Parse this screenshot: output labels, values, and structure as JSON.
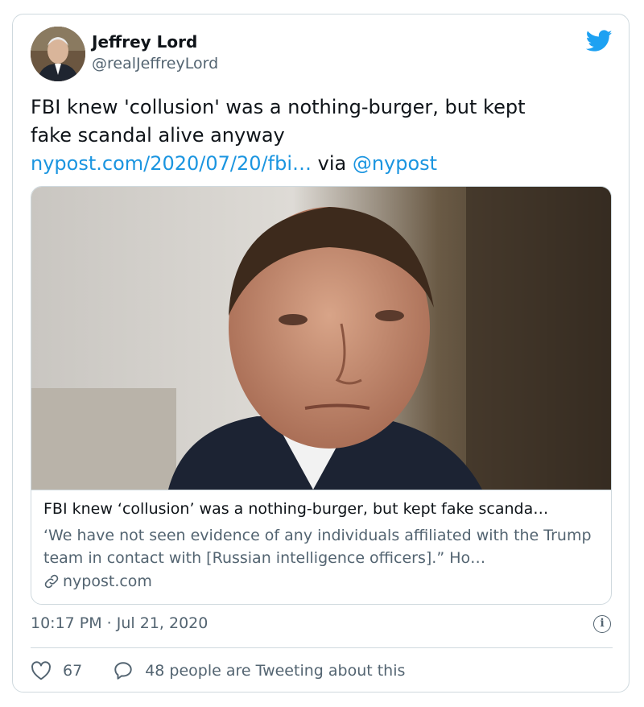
{
  "author": {
    "name": "Jeffrey Lord",
    "handle": "@realJeffreyLord"
  },
  "tweet": {
    "text_line1": "FBI knew 'collusion' was a nothing-burger, but kept",
    "text_line2": "fake scandal alive anyway",
    "link_text": "nypost.com/2020/07/20/fbi…",
    "via": " via ",
    "mention": "@nypost"
  },
  "card": {
    "title": "FBI knew ‘collusion’ was a nothing-burger, but kept fake scanda…",
    "description": "‘We have not seen evidence of any individuals affiliated with the Trump team in contact with [Russian intelligence officers].” Ho…",
    "domain": "nypost.com"
  },
  "meta": {
    "timestamp": "10:17 PM · Jul 21, 2020",
    "info_glyph": "i"
  },
  "actions": {
    "likes": "67",
    "tweeting": "48 people are Tweeting about this"
  },
  "icons": {
    "brand": "twitter-bird-icon",
    "heart": "heart-icon",
    "reply": "speech-bubble-icon",
    "link": "link-icon",
    "info": "info-icon"
  },
  "colors": {
    "link": "#1b95e0",
    "brand": "#1da1f2",
    "secondary_text": "#536471",
    "border": "#cfd9de"
  }
}
